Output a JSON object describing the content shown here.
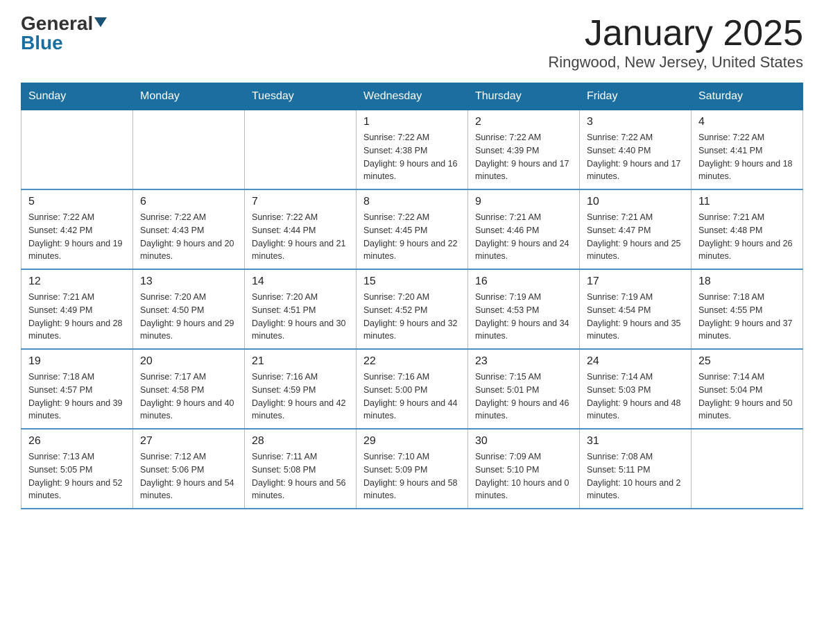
{
  "logo": {
    "general": "General",
    "blue": "Blue"
  },
  "title": "January 2025",
  "subtitle": "Ringwood, New Jersey, United States",
  "weekdays": [
    "Sunday",
    "Monday",
    "Tuesday",
    "Wednesday",
    "Thursday",
    "Friday",
    "Saturday"
  ],
  "weeks": [
    [
      {
        "num": "",
        "info": ""
      },
      {
        "num": "",
        "info": ""
      },
      {
        "num": "",
        "info": ""
      },
      {
        "num": "1",
        "info": "Sunrise: 7:22 AM\nSunset: 4:38 PM\nDaylight: 9 hours\nand 16 minutes."
      },
      {
        "num": "2",
        "info": "Sunrise: 7:22 AM\nSunset: 4:39 PM\nDaylight: 9 hours\nand 17 minutes."
      },
      {
        "num": "3",
        "info": "Sunrise: 7:22 AM\nSunset: 4:40 PM\nDaylight: 9 hours\nand 17 minutes."
      },
      {
        "num": "4",
        "info": "Sunrise: 7:22 AM\nSunset: 4:41 PM\nDaylight: 9 hours\nand 18 minutes."
      }
    ],
    [
      {
        "num": "5",
        "info": "Sunrise: 7:22 AM\nSunset: 4:42 PM\nDaylight: 9 hours\nand 19 minutes."
      },
      {
        "num": "6",
        "info": "Sunrise: 7:22 AM\nSunset: 4:43 PM\nDaylight: 9 hours\nand 20 minutes."
      },
      {
        "num": "7",
        "info": "Sunrise: 7:22 AM\nSunset: 4:44 PM\nDaylight: 9 hours\nand 21 minutes."
      },
      {
        "num": "8",
        "info": "Sunrise: 7:22 AM\nSunset: 4:45 PM\nDaylight: 9 hours\nand 22 minutes."
      },
      {
        "num": "9",
        "info": "Sunrise: 7:21 AM\nSunset: 4:46 PM\nDaylight: 9 hours\nand 24 minutes."
      },
      {
        "num": "10",
        "info": "Sunrise: 7:21 AM\nSunset: 4:47 PM\nDaylight: 9 hours\nand 25 minutes."
      },
      {
        "num": "11",
        "info": "Sunrise: 7:21 AM\nSunset: 4:48 PM\nDaylight: 9 hours\nand 26 minutes."
      }
    ],
    [
      {
        "num": "12",
        "info": "Sunrise: 7:21 AM\nSunset: 4:49 PM\nDaylight: 9 hours\nand 28 minutes."
      },
      {
        "num": "13",
        "info": "Sunrise: 7:20 AM\nSunset: 4:50 PM\nDaylight: 9 hours\nand 29 minutes."
      },
      {
        "num": "14",
        "info": "Sunrise: 7:20 AM\nSunset: 4:51 PM\nDaylight: 9 hours\nand 30 minutes."
      },
      {
        "num": "15",
        "info": "Sunrise: 7:20 AM\nSunset: 4:52 PM\nDaylight: 9 hours\nand 32 minutes."
      },
      {
        "num": "16",
        "info": "Sunrise: 7:19 AM\nSunset: 4:53 PM\nDaylight: 9 hours\nand 34 minutes."
      },
      {
        "num": "17",
        "info": "Sunrise: 7:19 AM\nSunset: 4:54 PM\nDaylight: 9 hours\nand 35 minutes."
      },
      {
        "num": "18",
        "info": "Sunrise: 7:18 AM\nSunset: 4:55 PM\nDaylight: 9 hours\nand 37 minutes."
      }
    ],
    [
      {
        "num": "19",
        "info": "Sunrise: 7:18 AM\nSunset: 4:57 PM\nDaylight: 9 hours\nand 39 minutes."
      },
      {
        "num": "20",
        "info": "Sunrise: 7:17 AM\nSunset: 4:58 PM\nDaylight: 9 hours\nand 40 minutes."
      },
      {
        "num": "21",
        "info": "Sunrise: 7:16 AM\nSunset: 4:59 PM\nDaylight: 9 hours\nand 42 minutes."
      },
      {
        "num": "22",
        "info": "Sunrise: 7:16 AM\nSunset: 5:00 PM\nDaylight: 9 hours\nand 44 minutes."
      },
      {
        "num": "23",
        "info": "Sunrise: 7:15 AM\nSunset: 5:01 PM\nDaylight: 9 hours\nand 46 minutes."
      },
      {
        "num": "24",
        "info": "Sunrise: 7:14 AM\nSunset: 5:03 PM\nDaylight: 9 hours\nand 48 minutes."
      },
      {
        "num": "25",
        "info": "Sunrise: 7:14 AM\nSunset: 5:04 PM\nDaylight: 9 hours\nand 50 minutes."
      }
    ],
    [
      {
        "num": "26",
        "info": "Sunrise: 7:13 AM\nSunset: 5:05 PM\nDaylight: 9 hours\nand 52 minutes."
      },
      {
        "num": "27",
        "info": "Sunrise: 7:12 AM\nSunset: 5:06 PM\nDaylight: 9 hours\nand 54 minutes."
      },
      {
        "num": "28",
        "info": "Sunrise: 7:11 AM\nSunset: 5:08 PM\nDaylight: 9 hours\nand 56 minutes."
      },
      {
        "num": "29",
        "info": "Sunrise: 7:10 AM\nSunset: 5:09 PM\nDaylight: 9 hours\nand 58 minutes."
      },
      {
        "num": "30",
        "info": "Sunrise: 7:09 AM\nSunset: 5:10 PM\nDaylight: 10 hours\nand 0 minutes."
      },
      {
        "num": "31",
        "info": "Sunrise: 7:08 AM\nSunset: 5:11 PM\nDaylight: 10 hours\nand 2 minutes."
      },
      {
        "num": "",
        "info": ""
      }
    ]
  ]
}
